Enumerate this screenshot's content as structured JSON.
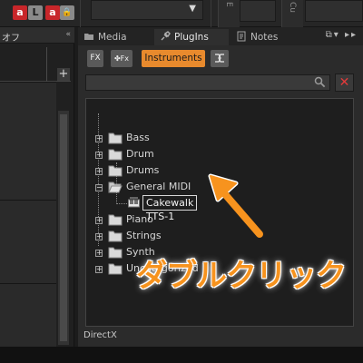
{
  "topbar": {
    "btn1_left": "a",
    "btn1_right": "L",
    "btn2_left": "a",
    "btn2_right": "🔒",
    "vertical_tabs": [
      "E",
      "Cu"
    ]
  },
  "left_panel": {
    "header_label": "オフ",
    "header_chevron": "«",
    "add_label": "+"
  },
  "browser": {
    "tabs": [
      {
        "label": "Media",
        "icon": "folder-icon"
      },
      {
        "label": "PlugIns",
        "icon": "plug-icon"
      },
      {
        "label": "Notes",
        "icon": "notes-icon"
      }
    ],
    "tabs_right_controls": "⧉▾ ▸▸",
    "filters": {
      "fx_label": "FX",
      "midi_fx_label": "Fx",
      "instruments_label": "Instruments",
      "active": "Instruments"
    },
    "search": {
      "value": "",
      "placeholder": ""
    },
    "close_label": "✕",
    "tree": [
      {
        "label": "Bass",
        "expanded": false
      },
      {
        "label": "Drum",
        "expanded": false
      },
      {
        "label": "Drums",
        "expanded": false
      },
      {
        "label": "General MIDI",
        "expanded": true
      },
      {
        "label": "Piano",
        "expanded": false
      },
      {
        "label": "Strings",
        "expanded": false
      },
      {
        "label": "Synth",
        "expanded": false
      },
      {
        "label": "Uncategorized",
        "expanded": false
      }
    ],
    "child_item": {
      "parent": "General MIDI",
      "label": "Cakewalk TTS-1",
      "selected": true
    },
    "status": "DirectX"
  },
  "annotation": {
    "caption": "ダブルクリック",
    "color": "#f7931e"
  }
}
